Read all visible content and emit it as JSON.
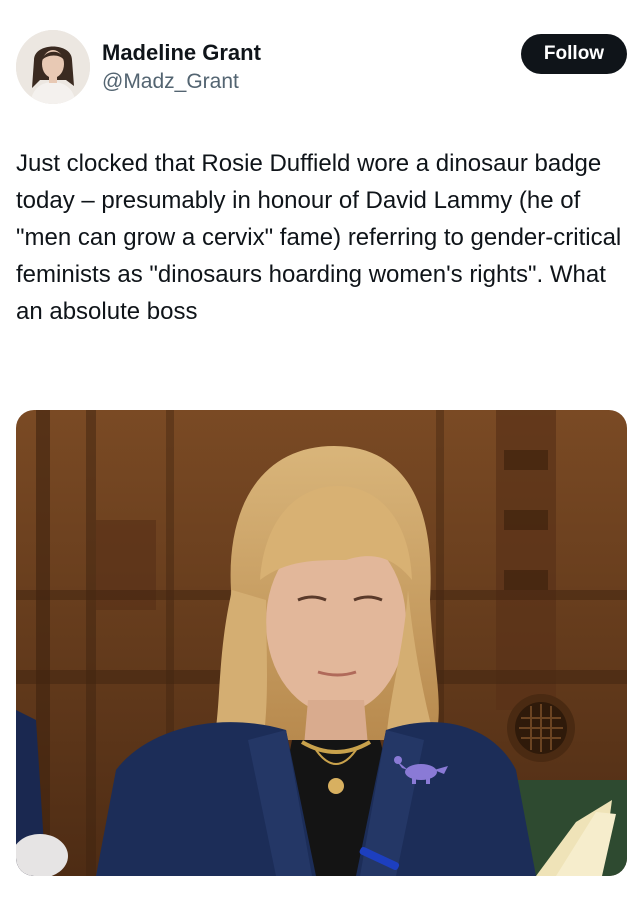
{
  "tweet": {
    "author": {
      "display_name": "Madeline Grant",
      "handle": "@Madz_Grant"
    },
    "follow_label": "Follow",
    "text": "Just clocked that Rosie Duffield wore a dinosaur badge today – presumably in honour of David Lammy (he of \"men can grow a cervix\" fame) referring to gender-critical feminists as \"dinosaurs hoarding women's rights\". What an absolute boss"
  },
  "colors": {
    "text_primary": "#0f1419",
    "text_secondary": "#536471",
    "button_bg": "#0f1419",
    "button_text": "#ffffff"
  }
}
